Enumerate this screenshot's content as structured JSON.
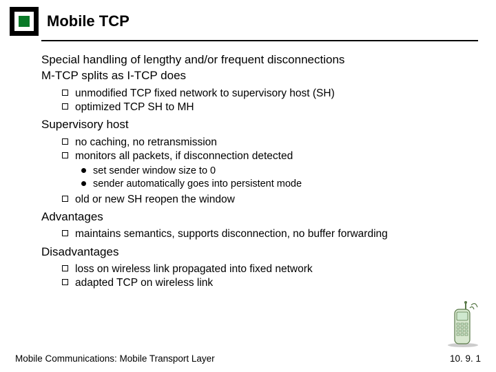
{
  "header": {
    "title": "Mobile TCP"
  },
  "body": {
    "p1": "Special handling of lengthy and/or frequent disconnections",
    "p2": "M-TCP splits as I-TCP does",
    "p2_sub": [
      "unmodified TCP fixed network to supervisory host (SH)",
      "optimized TCP SH to MH"
    ],
    "p3": "Supervisory host",
    "p3_sub1": "no caching, no retransmission",
    "p3_sub2": "monitors all packets, if disconnection detected",
    "p3_sub2_dots": [
      "set sender window size to 0",
      "sender automatically goes into persistent mode"
    ],
    "p3_sub3": "old or new SH reopen the window",
    "p4": "Advantages",
    "p4_sub": [
      "maintains semantics, supports disconnection, no buffer forwarding"
    ],
    "p5": "Disadvantages",
    "p5_sub": [
      "loss on wireless link propagated into fixed network",
      "adapted TCP on wireless link"
    ]
  },
  "footer": {
    "left": "Mobile Communications: Mobile Transport Layer",
    "right": "10. 9. 1"
  }
}
